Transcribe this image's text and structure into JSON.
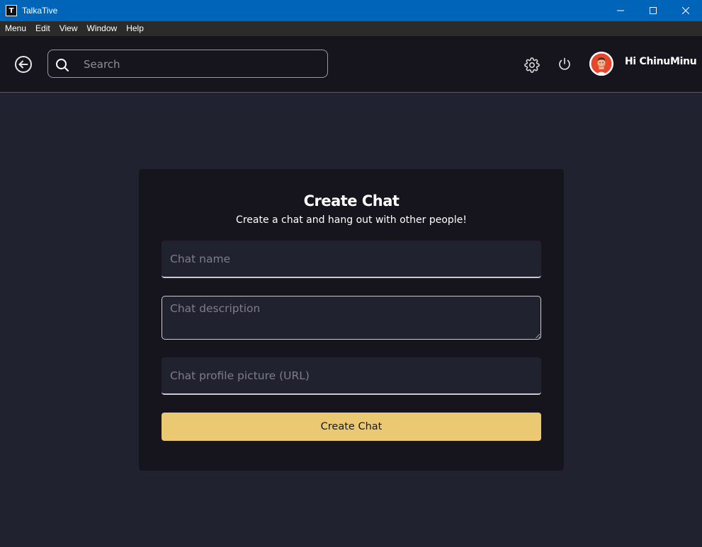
{
  "window": {
    "title": "TalkaTive",
    "app_icon_glyph": "T"
  },
  "menubar": {
    "items": [
      "Menu",
      "Edit",
      "View",
      "Window",
      "Help"
    ]
  },
  "header": {
    "search_placeholder": "Search",
    "greeting": "Hi ChinuMinu"
  },
  "card": {
    "title": "Create Chat",
    "subtitle": "Create a chat and hang out with other people!",
    "chat_name_placeholder": "Chat name",
    "chat_description_placeholder": "Chat description",
    "chat_picture_placeholder": "Chat profile picture (URL)",
    "submit_label": "Create Chat"
  },
  "colors": {
    "titlebar": "#0065b8",
    "background": "#21222f",
    "surface": "#16151d",
    "accent": "#ebc872"
  },
  "icons": [
    "back-arrow-icon",
    "search-icon",
    "gear-icon",
    "power-icon",
    "avatar"
  ]
}
